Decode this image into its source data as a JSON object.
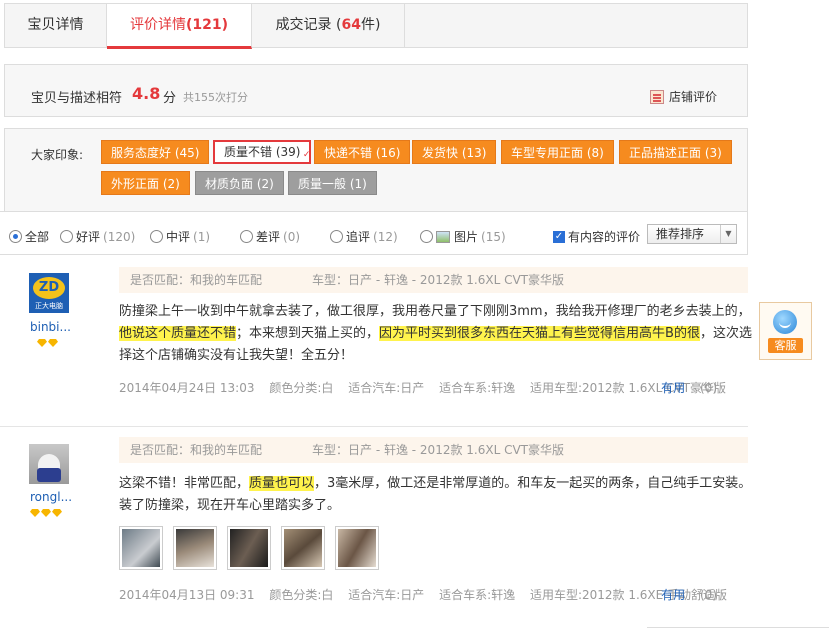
{
  "tabs": [
    {
      "label": "宝贝详情",
      "count": ""
    },
    {
      "label": "评价详情",
      "count": "121"
    },
    {
      "label": "成交记录 (",
      "count": "64",
      "suffix": "件)"
    }
  ],
  "rating": {
    "desc": "宝贝与描述相符",
    "score": "4.8",
    "unit": "分",
    "count_text": "共155次打分",
    "shop_link": "店铺评价"
  },
  "impressions": {
    "label": "大家印象:",
    "tags": [
      "服务态度好 (45)",
      "质量不错 (39)",
      "快递不错 (16)",
      "发货快 (13)",
      "车型专用正面 (8)",
      "正品描述正面 (3)",
      "外形正面 (2)",
      "材质负面 (2)",
      "质量一般 (1)"
    ]
  },
  "filter": {
    "all": "全部",
    "good": "好评",
    "good_n": "(120)",
    "mid": "中评",
    "mid_n": "(1)",
    "bad": "差评",
    "bad_n": "(0)",
    "append": "追评",
    "append_n": "(12)",
    "pic": "图片",
    "pic_n": "(15)",
    "has_content": "有内容的评价",
    "sort": "推荐排序"
  },
  "reviews": [
    {
      "user": "binbi...",
      "avatar_text": "ZD",
      "avatar_sub": "正大电脑",
      "match": "是否匹配：和我的车匹配",
      "car": "车型：日产 - 轩逸 - 2012款 1.6XL CVT豪华版",
      "text_a": "防撞梁上午一收到中午就拿去装了，做工很厚，我用卷尺量了下刚刚3mm，我给我开修理厂的老乡去装上的，",
      "text_hl1": "他说这个质量还不错",
      "text_b": "；本来想到天猫上买的，",
      "text_hl2": "因为平时买到很多东西在天猫上有些觉得信用高牛B的很",
      "text_c": "，这次选择这个店铺确实没有让我失望！全五分！",
      "date": "2014年04月24日 13:03",
      "color": "颜色分类:白",
      "fit_car": "适合汽车:日产",
      "fit_series": "适合车系:轩逸",
      "fit_model": "适用车型:2012款 1.6XL CVT豪华版",
      "useful": "有用",
      "useful_n": "(0)"
    },
    {
      "user": "rongl...",
      "match": "是否匹配：和我的车匹配",
      "car": "车型：日产 - 轩逸 - 2012款 1.6XL CVT豪华版",
      "text_a": "这梁不错！非常匹配，",
      "text_hl1": "质量也可以",
      "text_b": "，3毫米厚，做工还是非常厚道的。和车友一起买的两条，自己纯手工安装。装了防撞梁，现在开车心里踏实多了。",
      "date": "2014年04月13日 09:31",
      "color": "颜色分类:白",
      "fit_car": "适合汽车:日产",
      "fit_series": "适合车系:轩逸",
      "fit_model": "适用车型:2012款 1.6XE 手动舒适版",
      "useful": "有用",
      "useful_n": "(0)"
    }
  ],
  "service": {
    "label": "客服"
  },
  "colors": {
    "accent": "#e4393c",
    "tag": "#f68b1f",
    "tag_gray": "#9e9e9e",
    "link": "#1e5fb4",
    "highlight": "#fff34d"
  }
}
